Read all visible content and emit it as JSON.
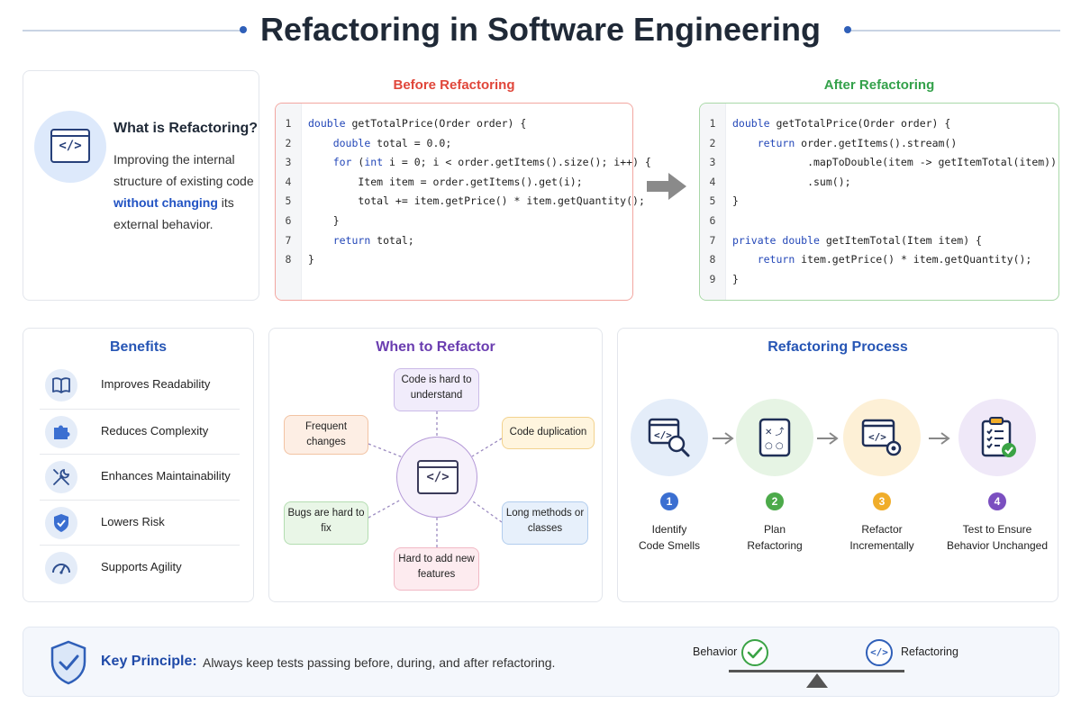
{
  "title": "Refactoring in Software Engineering",
  "what": {
    "title": "What is Refactoring?",
    "body_pre": "Improving the internal structure of existing code ",
    "body_highlight": "without changing",
    "body_post": " its external behavior."
  },
  "before": {
    "heading": "Before Refactoring",
    "lines": [
      {
        "n": "1",
        "code": "double getTotalPrice(Order order) {"
      },
      {
        "n": "2",
        "code": "    double total = 0.0;"
      },
      {
        "n": "3",
        "code": "    for (int i = 0; i < order.getItems().size(); i++) {"
      },
      {
        "n": "4",
        "code": "        Item item = order.getItems().get(i);"
      },
      {
        "n": "5",
        "code": "        total += item.getPrice() * item.getQuantity();"
      },
      {
        "n": "6",
        "code": "    }"
      },
      {
        "n": "7",
        "code": "    return total;"
      },
      {
        "n": "8",
        "code": "}"
      }
    ]
  },
  "after": {
    "heading": "After Refactoring",
    "lines": [
      {
        "n": "1",
        "code": "double getTotalPrice(Order order) {"
      },
      {
        "n": "2",
        "code": "    return order.getItems().stream()"
      },
      {
        "n": "3",
        "code": "            .mapToDouble(item -> getItemTotal(item))"
      },
      {
        "n": "4",
        "code": "            .sum();"
      },
      {
        "n": "5",
        "code": "}"
      },
      {
        "n": "6",
        "code": ""
      },
      {
        "n": "7",
        "code": "private double getItemTotal(Item item) {"
      },
      {
        "n": "8",
        "code": "    return item.getPrice() * item.getQuantity();"
      },
      {
        "n": "9",
        "code": "}"
      }
    ]
  },
  "benefits": {
    "title": "Benefits",
    "items": [
      {
        "label": "Improves Readability",
        "icon": "book-icon"
      },
      {
        "label": "Reduces Complexity",
        "icon": "puzzle-icon"
      },
      {
        "label": "Enhances Maintainability",
        "icon": "tools-icon"
      },
      {
        "label": "Lowers Risk",
        "icon": "shield-check-icon"
      },
      {
        "label": "Supports Agility",
        "icon": "gauge-icon"
      }
    ]
  },
  "when": {
    "title": "When to Refactor",
    "items": [
      {
        "label": "Code is hard to understand",
        "fill": "#f1ecfb",
        "stroke": "#cbbbe8"
      },
      {
        "label": "Frequent changes",
        "fill": "#fdeee4",
        "stroke": "#f2c3a3"
      },
      {
        "label": "Code duplication",
        "fill": "#fff5de",
        "stroke": "#f2d28e"
      },
      {
        "label": "Bugs are hard to fix",
        "fill": "#e9f6e7",
        "stroke": "#b4ddb1"
      },
      {
        "label": "Long methods or classes",
        "fill": "#e7f0fb",
        "stroke": "#b2cdee"
      },
      {
        "label": "Hard to add new features",
        "fill": "#fdebef",
        "stroke": "#f1b9c5"
      }
    ]
  },
  "process": {
    "title": "Refactoring Process",
    "steps": [
      {
        "num": "1",
        "label_1": "Identify",
        "label_2": "Code Smells",
        "icon": "magnifier-code-icon",
        "bg": "#e4edf9",
        "color": "#3b6fd1"
      },
      {
        "num": "2",
        "label_1": "Plan",
        "label_2": "Refactoring",
        "icon": "plan-board-icon",
        "bg": "#e6f4e4",
        "color": "#4caa4a"
      },
      {
        "num": "3",
        "label_1": "Refactor",
        "label_2": "Incrementally",
        "icon": "code-gear-icon",
        "bg": "#fdf0d6",
        "color": "#f0ad2a"
      },
      {
        "num": "4",
        "label_1": "Test to Ensure",
        "label_2": "Behavior Unchanged",
        "icon": "clipboard-check-icon",
        "bg": "#efe8f8",
        "color": "#7b4fc0"
      }
    ]
  },
  "key": {
    "label": "Key Principle:",
    "text": "Always keep tests passing before, during, and after refactoring.",
    "left_label": "Behavior",
    "right_label": "Refactoring"
  },
  "colors": {
    "accent_blue": "#2756b5",
    "before_red": "#e0463a",
    "after_green": "#33a14a",
    "purple": "#6a3db0"
  }
}
